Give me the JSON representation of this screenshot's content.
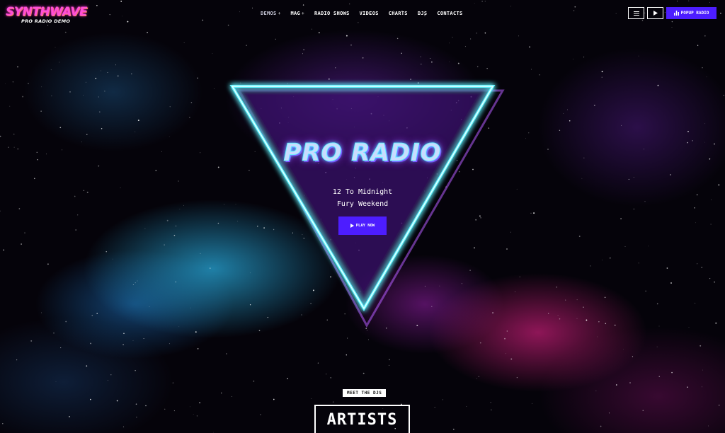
{
  "brand": {
    "title": "SYNTHWAVE",
    "subtitle": "PRO RADIO DEMO"
  },
  "nav": [
    {
      "label": "DEMOS",
      "has_dropdown": true,
      "active": true
    },
    {
      "label": "MAG",
      "has_dropdown": true,
      "active": false
    },
    {
      "label": "RADIO SHOWS",
      "has_dropdown": false,
      "active": false
    },
    {
      "label": "VIDEOS",
      "has_dropdown": false,
      "active": false
    },
    {
      "label": "CHARTS",
      "has_dropdown": false,
      "active": false
    },
    {
      "label": "DJS",
      "has_dropdown": false,
      "active": false
    },
    {
      "label": "CONTACTS",
      "has_dropdown": false,
      "active": false
    }
  ],
  "toolbar": {
    "menu_icon": "list-icon",
    "play_icon": "play-icon",
    "popup_icon": "equalizer-icon",
    "popup_label": "POPUP RADIO"
  },
  "hero": {
    "title": "PRO RADIO",
    "line1": "12 To Midnight",
    "line2": "Fury Weekend",
    "play_label": "PLAY NOW"
  },
  "section": {
    "kicker": "MEET THE DJS",
    "title": "ARTISTS"
  },
  "colors": {
    "accent": "#4d1dff",
    "neon_cyan": "#5ff6ff",
    "neon_purple": "#a73bff",
    "brand_pink": "#ff4fd8"
  }
}
